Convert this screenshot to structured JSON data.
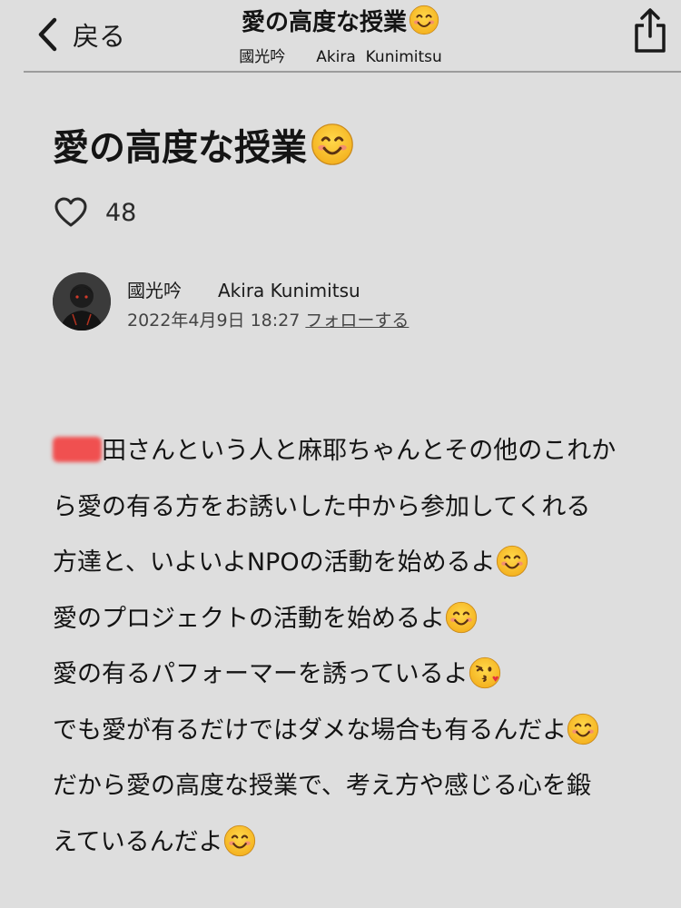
{
  "nav": {
    "back_label": "戻る",
    "title": "愛の高度な授業",
    "subtitle": "國光吟　　Akira  Kunimitsu"
  },
  "article": {
    "title": "愛の高度な授業",
    "like_count": "48",
    "author": {
      "name": "國光吟　　Akira Kunimitsu",
      "date": "2022年4月9日 18:27",
      "follow_label": "フォローする"
    },
    "body": {
      "line1": "田さんという人と麻耶ちゃんとその他のこれか",
      "line2": "ら愛の有る方をお誘いした中から参加してくれる",
      "line3": "方達と、いよいよNPOの活動を始めるよ",
      "line4": "愛のプロジェクトの活動を始めるよ",
      "line5": "愛の有るパフォーマーを誘っているよ",
      "line6": "でも愛が有るだけではダメな場合も有るんだよ",
      "line7": "だから愛の高度な授業で、考え方や感じる心を鍛",
      "line8": "えているんだよ"
    }
  },
  "icons": {
    "back": "chevron-left-icon",
    "share": "share-icon",
    "like": "heart-outline-icon",
    "smile": "smiling-face-emoji",
    "kiss": "kissing-face-emoji"
  },
  "colors": {
    "background": "#dedede",
    "text": "#141414",
    "redaction": "#f05050",
    "emoji_face": "#f7c325"
  }
}
